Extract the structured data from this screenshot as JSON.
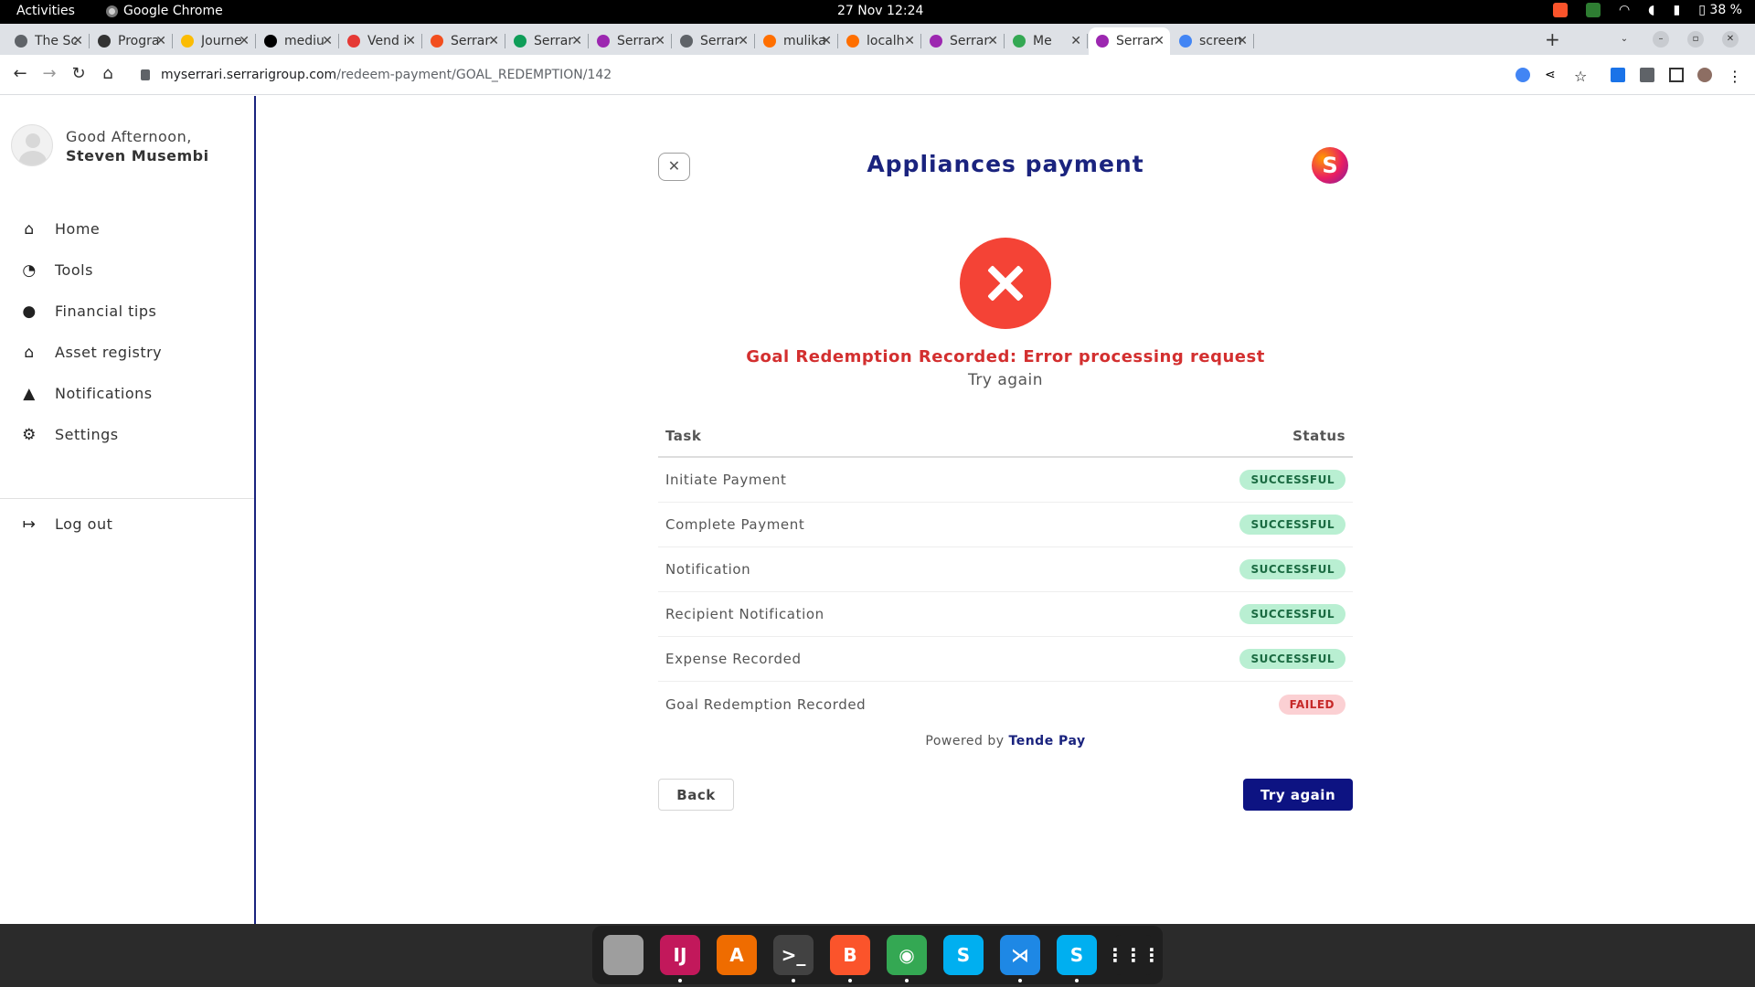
{
  "os": {
    "activities": "Activities",
    "app_name": "Google Chrome",
    "clock": "27 Nov  12:24",
    "battery": "38 %"
  },
  "browser": {
    "tabs": [
      {
        "label": "The Sc",
        "color": "#5f6368"
      },
      {
        "label": "Progra",
        "color": "#333333"
      },
      {
        "label": "Journe",
        "color": "#fbbc04"
      },
      {
        "label": "mediu",
        "color": "#000000"
      },
      {
        "label": "Vend i",
        "color": "#e53935"
      },
      {
        "label": "Serrar",
        "color": "#f24e1e"
      },
      {
        "label": "Serrar",
        "color": "#0f9d58"
      },
      {
        "label": "Serrar",
        "color": "#9c27b0"
      },
      {
        "label": "Serrar",
        "color": "#5f6368"
      },
      {
        "label": "mulika",
        "color": "#ff6f00"
      },
      {
        "label": "localh",
        "color": "#ff6f00"
      },
      {
        "label": "Serrar",
        "color": "#9c27b0"
      },
      {
        "label": "Me",
        "color": "#34a853"
      },
      {
        "label": "Serrar",
        "color": "#9c27b0"
      },
      {
        "label": "screen",
        "color": "#4285f4"
      }
    ],
    "url_host": "myserrari.serrarigroup.com",
    "url_path": "/redeem-payment/GOAL_REDEMPTION/142"
  },
  "sidebar": {
    "greeting": "Good Afternoon,",
    "user_name": "Steven Musembi",
    "items": [
      {
        "label": "Home",
        "icon": "home-icon",
        "glyph": "⌂"
      },
      {
        "label": "Tools",
        "icon": "pie-chart-icon",
        "glyph": "◔"
      },
      {
        "label": "Financial tips",
        "icon": "chat-icon",
        "glyph": "●"
      },
      {
        "label": "Asset registry",
        "icon": "asset-icon",
        "glyph": "⌂"
      },
      {
        "label": "Notifications",
        "icon": "bell-icon",
        "glyph": "▲"
      },
      {
        "label": "Settings",
        "icon": "gear-icon",
        "glyph": "⚙"
      }
    ],
    "logout": {
      "label": "Log out",
      "icon": "logout-icon",
      "glyph": "↦"
    }
  },
  "main": {
    "title": "Appliances payment",
    "close_glyph": "✕",
    "logo_letter": "S",
    "error_message": "Goal Redemption Recorded: Error processing request",
    "error_sub": "Try again",
    "table": {
      "col_task": "Task",
      "col_status": "Status",
      "rows": [
        {
          "task": "Initiate Payment",
          "status": "SUCCESSFUL",
          "ok": true
        },
        {
          "task": "Complete Payment",
          "status": "SUCCESSFUL",
          "ok": true
        },
        {
          "task": "Notification",
          "status": "SUCCESSFUL",
          "ok": true
        },
        {
          "task": "Recipient Notification",
          "status": "SUCCESSFUL",
          "ok": true
        },
        {
          "task": "Expense Recorded",
          "status": "SUCCESSFUL",
          "ok": true
        },
        {
          "task": "Goal Redemption Recorded",
          "status": "FAILED",
          "ok": false
        }
      ]
    },
    "powered_by": "Powered by",
    "powered_brand": "Tende Pay",
    "back_label": "Back",
    "try_again_label": "Try again"
  },
  "dock": [
    {
      "name": "files",
      "color": "#9e9e9e",
      "glyph": "",
      "running": false
    },
    {
      "name": "intellij",
      "color": "#c2185b",
      "glyph": "IJ",
      "running": true
    },
    {
      "name": "app-center",
      "color": "#ef6c00",
      "glyph": "A",
      "running": false
    },
    {
      "name": "terminal",
      "color": "#424242",
      "glyph": ">_",
      "running": true
    },
    {
      "name": "brave",
      "color": "#fb542b",
      "glyph": "B",
      "running": true
    },
    {
      "name": "chrome",
      "color": "#34a853",
      "glyph": "◉",
      "running": true
    },
    {
      "name": "skype",
      "color": "#00aff0",
      "glyph": "S",
      "running": false
    },
    {
      "name": "vscode",
      "color": "#1e88e5",
      "glyph": "⋊",
      "running": true
    },
    {
      "name": "skype-2",
      "color": "#00aff0",
      "glyph": "S",
      "running": true
    },
    {
      "name": "app-grid",
      "color": "#1f1f1f",
      "glyph": "⋮⋮⋮",
      "running": false
    }
  ]
}
